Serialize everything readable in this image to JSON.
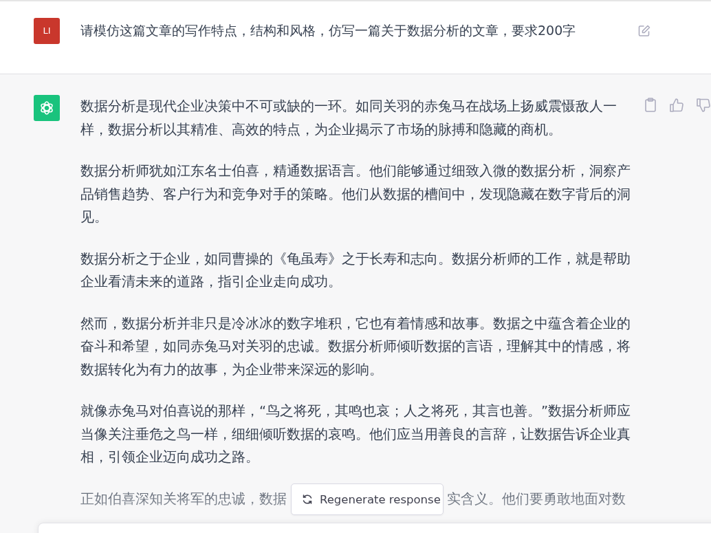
{
  "user_message": {
    "avatar": "LI",
    "text": "请模仿这篇文章的写作特点，结构和风格，仿写一篇关于数据分析的文章，要求200字"
  },
  "assistant_message": {
    "paragraphs": [
      "数据分析是现代企业决策中不可或缺的一环。如同关羽的赤兔马在战场上扬威震慑敌人一样，数据分析以其精准、高效的特点，为企业揭示了市场的脉搏和隐藏的商机。",
      "数据分析师犹如江东名士伯喜，精通数据语言。他们能够通过细致入微的数据分析，洞察产品销售趋势、客户行为和竞争对手的策略。他们从数据的槽间中，发现隐藏在数字背后的洞见。",
      "数据分析之于企业，如同曹操的《龟虽寿》之于长寿和志向。数据分析师的工作，就是帮助企业看清未来的道路，指引企业走向成功。",
      "然而，数据分析并非只是冷冰冰的数字堆积，它也有着情感和故事。数据之中蕴含着企业的奋斗和希望，如同赤兔马对关羽的忠诚。数据分析师倾听数据的言语，理解其中的情感，将数据转化为有力的故事，为企业带来深远的影响。",
      "就像赤兔马对伯喜说的那样，“鸟之将死，其鸣也哀；人之将死，其言也善。”数据分析师应当像关注垂危之鸟一样，细细倾听数据的哀鸣。他们应当用善良的言辞，让数据告诉企业真相，引领企业迈向成功之路。"
    ],
    "partial_line": [
      "正如伯喜深知关将军的忠诚，数据",
      "实含义。他们要勇敢地面对数"
    ]
  },
  "regenerate_button": {
    "label": "Regenerate response"
  }
}
